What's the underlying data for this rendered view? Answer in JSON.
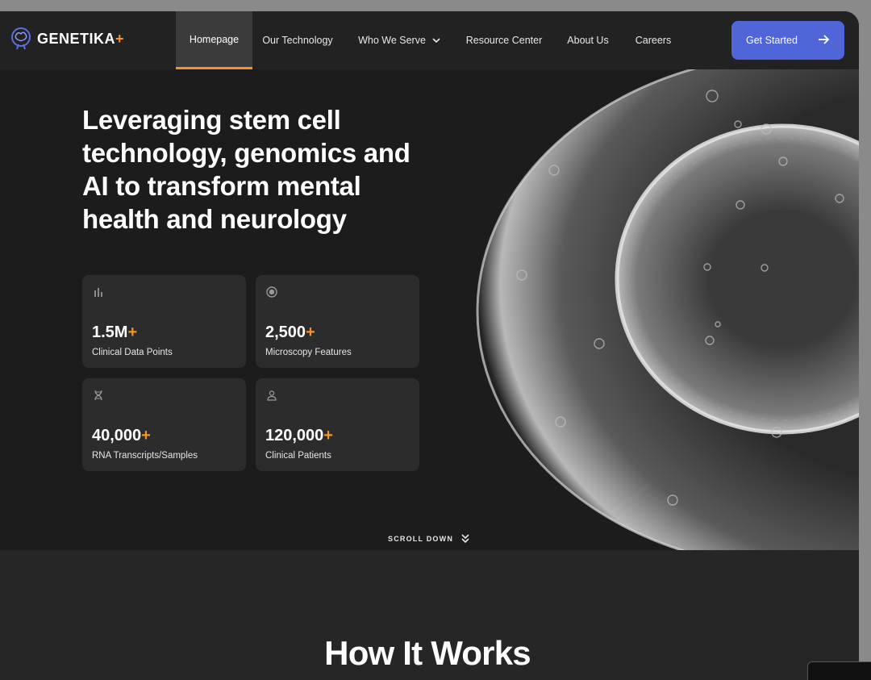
{
  "brand": {
    "name": "GENETIKA",
    "plus": "+",
    "accent": "#f2952b",
    "cta_color": "#5065d8"
  },
  "nav": {
    "items": [
      {
        "label": "Homepage",
        "active": true
      },
      {
        "label": "Our Technology"
      },
      {
        "label": "Who We Serve",
        "has_dropdown": true
      },
      {
        "label": "Resource Center"
      },
      {
        "label": "About Us"
      },
      {
        "label": "Careers"
      }
    ],
    "cta": "Get Started"
  },
  "hero": {
    "headline": "Leveraging stem cell technology, genomics and AI to transform mental health and neurology",
    "stats": [
      {
        "icon": "bar-chart-icon",
        "value": "1.5M",
        "plus": "+",
        "label": "Clinical Data Points"
      },
      {
        "icon": "target-icon",
        "value": "2,500",
        "plus": "+",
        "label": "Microscopy Features"
      },
      {
        "icon": "dna-icon",
        "value": "40,000",
        "plus": "+",
        "label": "RNA Transcripts/Samples"
      },
      {
        "icon": "user-icon",
        "value": "120,000",
        "plus": "+",
        "label": "Clinical Patients"
      }
    ],
    "scroll_label": "SCROLL DOWN"
  },
  "how_it_works": {
    "title": "How It Works"
  }
}
